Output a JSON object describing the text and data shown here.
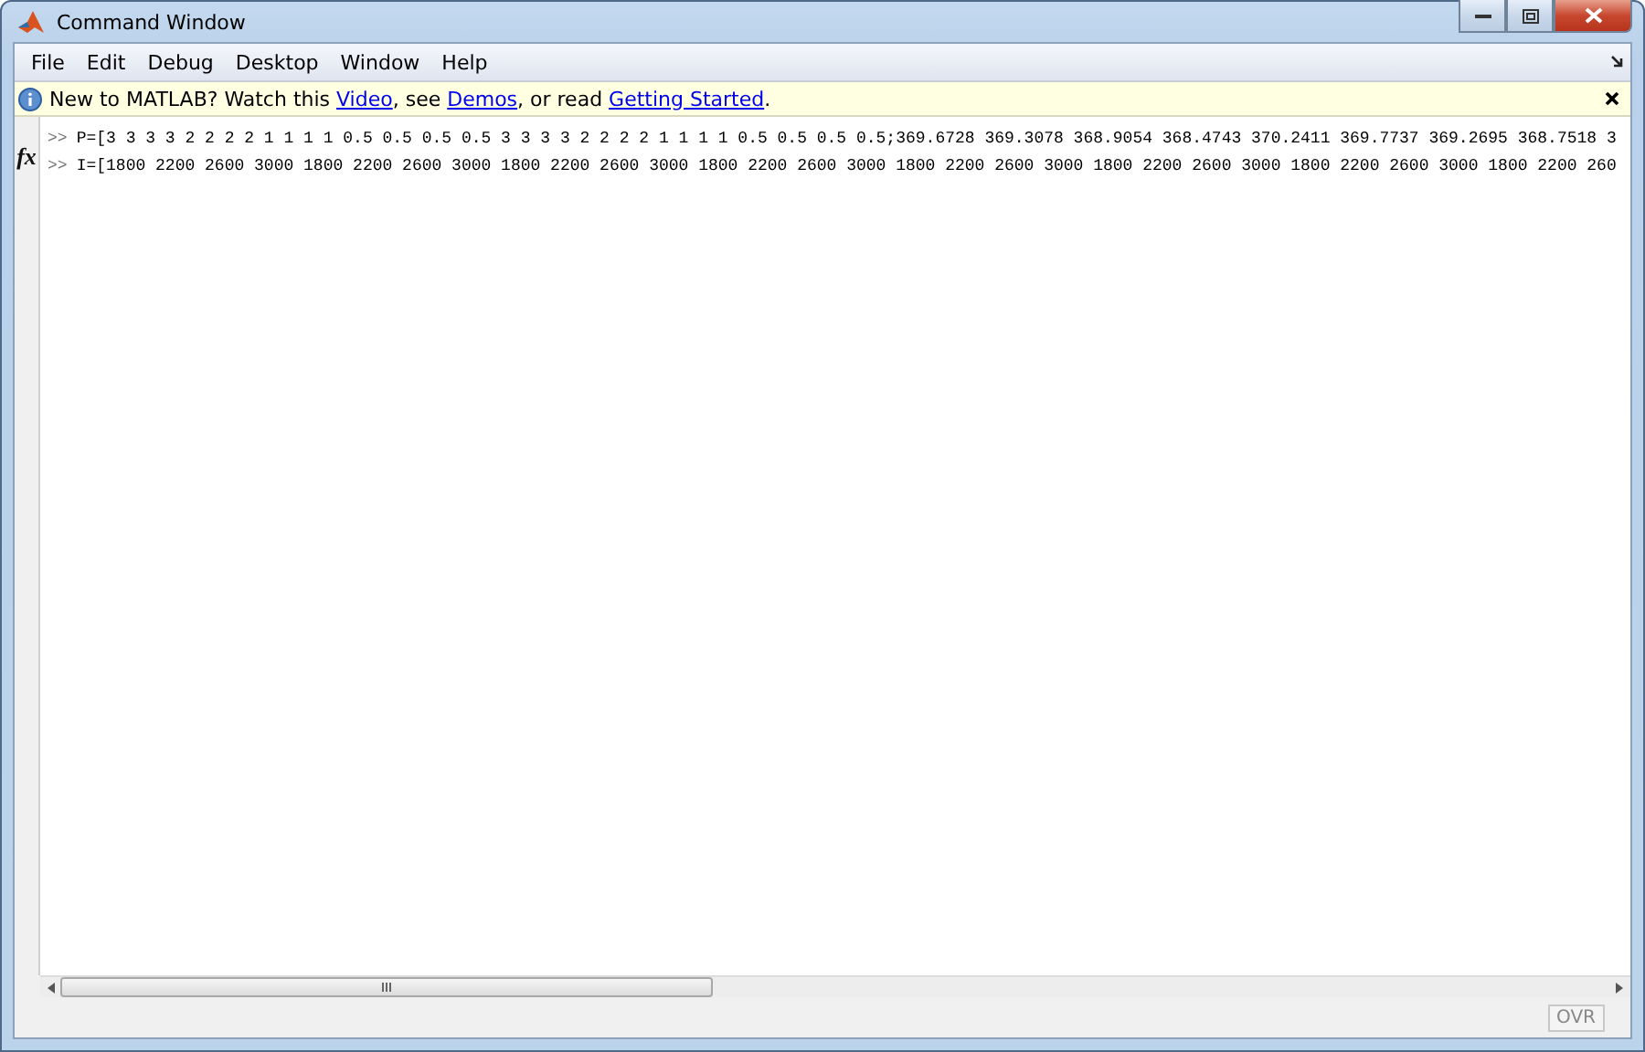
{
  "window": {
    "title": "Command Window"
  },
  "menu": [
    {
      "label": "File"
    },
    {
      "label": "Edit"
    },
    {
      "label": "Debug"
    },
    {
      "label": "Desktop"
    },
    {
      "label": "Window"
    },
    {
      "label": "Help"
    }
  ],
  "info_bar": {
    "segments": [
      {
        "kind": "text",
        "text": "New to MATLAB? Watch this "
      },
      {
        "kind": "link",
        "text": "Video"
      },
      {
        "kind": "text",
        "text": ", see "
      },
      {
        "kind": "link",
        "text": "Demos"
      },
      {
        "kind": "text",
        "text": ", or read "
      },
      {
        "kind": "link",
        "text": "Getting Started"
      },
      {
        "kind": "text",
        "text": "."
      }
    ]
  },
  "command_lines": [
    {
      "prompt": ">>",
      "text": "P=[3 3 3 3 2 2 2 2 1 1 1 1 0.5 0.5 0.5 0.5 3 3 3 3 2 2 2 2 1 1 1 1 0.5 0.5 0.5 0.5;369.6728 369.3078 368.9054 368.4743 370.2411 369.7737 369.2695 368.7518 3"
    },
    {
      "prompt": ">>",
      "text": "I=[1800 2200 2600 3000 1800 2200 2600 3000 1800 2200 2600 3000 1800 2200 2600 3000 1800 2200 2600 3000 1800 2200 2600 3000 1800 2200 2600 3000 1800 2200 260"
    }
  ],
  "function_browser": {
    "label": "fx"
  },
  "status_bar": {
    "indicator": "OVR"
  }
}
